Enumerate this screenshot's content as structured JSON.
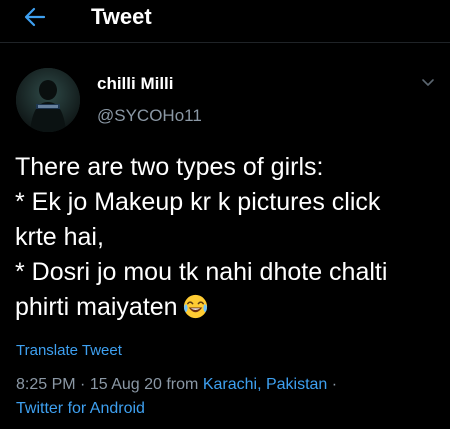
{
  "header": {
    "title": "Tweet",
    "back_icon": "arrow-left-icon"
  },
  "author": {
    "display_name": "chilli Milli",
    "handle": "@SYCOHo11",
    "more_icon": "chevron-down-icon"
  },
  "tweet": {
    "lines": [
      "There are two types of girls:",
      "* Ek jo Makeup kr k pictures click",
      "krte hai,",
      "* Dosri jo mou tk nahi dhote chalti",
      "phirti maiyaten"
    ],
    "emoji": "face-with-tears-of-joy-emoji"
  },
  "translate_label": "Translate Tweet",
  "meta": {
    "time": "8:25 PM",
    "separator": "·",
    "date": "15 Aug 20",
    "from_label": "from",
    "location": "Karachi, Pakistan",
    "source": "Twitter for Android"
  },
  "colors": {
    "background": "#000000",
    "accent": "#3ea0f0",
    "muted_text": "#8b98a5",
    "text": "#ffffff"
  }
}
